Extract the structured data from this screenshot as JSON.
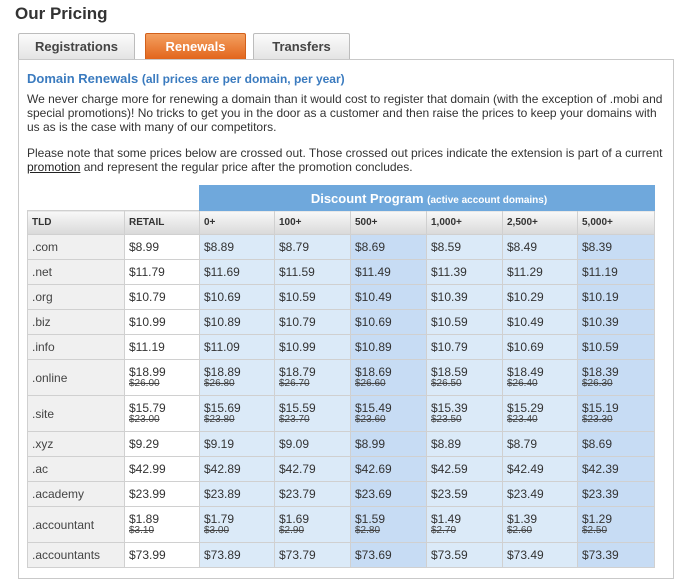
{
  "page_title": "Our Pricing",
  "tabs": [
    {
      "label": "Registrations",
      "active": false
    },
    {
      "label": "Renewals",
      "active": true
    },
    {
      "label": "Transfers",
      "active": false
    }
  ],
  "heading": {
    "title": "Domain Renewals",
    "subtitle": "(all prices are per domain, per year)"
  },
  "intro": "We never charge more for renewing a domain than it would cost to register that domain (with the exception of .mobi and special promotions)! No tricks to get you in the door as a customer and then raise the prices to keep your domains with us as is the case with many of our competitors.",
  "note": {
    "before": "Please note that some prices below are crossed out. Those crossed out prices indicate the extension is part of a current ",
    "link": "promotion",
    "after": " and represent the regular price after the promotion concludes."
  },
  "discount_header": {
    "title": "Discount Program",
    "subtitle": "(active account domains)"
  },
  "columns": [
    "TLD",
    "RETAIL",
    "0+",
    "100+",
    "500+",
    "1,000+",
    "2,500+",
    "5,000+"
  ],
  "colors": {
    "tab_active": "#e2651c",
    "heading": "#3b7bbf",
    "discount_header": "#6fa8dc"
  },
  "rows": [
    {
      "tld": ".com",
      "prices": [
        {
          "p": "$8.99"
        },
        {
          "p": "$8.89"
        },
        {
          "p": "$8.79"
        },
        {
          "p": "$8.69"
        },
        {
          "p": "$8.59"
        },
        {
          "p": "$8.49"
        },
        {
          "p": "$8.39"
        }
      ]
    },
    {
      "tld": ".net",
      "prices": [
        {
          "p": "$11.79"
        },
        {
          "p": "$11.69"
        },
        {
          "p": "$11.59"
        },
        {
          "p": "$11.49"
        },
        {
          "p": "$11.39"
        },
        {
          "p": "$11.29"
        },
        {
          "p": "$11.19"
        }
      ]
    },
    {
      "tld": ".org",
      "prices": [
        {
          "p": "$10.79"
        },
        {
          "p": "$10.69"
        },
        {
          "p": "$10.59"
        },
        {
          "p": "$10.49"
        },
        {
          "p": "$10.39"
        },
        {
          "p": "$10.29"
        },
        {
          "p": "$10.19"
        }
      ]
    },
    {
      "tld": ".biz",
      "prices": [
        {
          "p": "$10.99"
        },
        {
          "p": "$10.89"
        },
        {
          "p": "$10.79"
        },
        {
          "p": "$10.69"
        },
        {
          "p": "$10.59"
        },
        {
          "p": "$10.49"
        },
        {
          "p": "$10.39"
        }
      ]
    },
    {
      "tld": ".info",
      "prices": [
        {
          "p": "$11.19"
        },
        {
          "p": "$11.09"
        },
        {
          "p": "$10.99"
        },
        {
          "p": "$10.89"
        },
        {
          "p": "$10.79"
        },
        {
          "p": "$10.69"
        },
        {
          "p": "$10.59"
        }
      ]
    },
    {
      "tld": ".online",
      "prices": [
        {
          "p": "$18.99",
          "old": "$26.00"
        },
        {
          "p": "$18.89",
          "old": "$26.80"
        },
        {
          "p": "$18.79",
          "old": "$26.70"
        },
        {
          "p": "$18.69",
          "old": "$26.60"
        },
        {
          "p": "$18.59",
          "old": "$26.50"
        },
        {
          "p": "$18.49",
          "old": "$26.40"
        },
        {
          "p": "$18.39",
          "old": "$26.30"
        }
      ]
    },
    {
      "tld": ".site",
      "prices": [
        {
          "p": "$15.79",
          "old": "$23.00"
        },
        {
          "p": "$15.69",
          "old": "$23.80"
        },
        {
          "p": "$15.59",
          "old": "$23.70"
        },
        {
          "p": "$15.49",
          "old": "$23.60"
        },
        {
          "p": "$15.39",
          "old": "$23.50"
        },
        {
          "p": "$15.29",
          "old": "$23.40"
        },
        {
          "p": "$15.19",
          "old": "$23.30"
        }
      ]
    },
    {
      "tld": ".xyz",
      "prices": [
        {
          "p": "$9.29"
        },
        {
          "p": "$9.19"
        },
        {
          "p": "$9.09"
        },
        {
          "p": "$8.99"
        },
        {
          "p": "$8.89"
        },
        {
          "p": "$8.79"
        },
        {
          "p": "$8.69"
        }
      ]
    },
    {
      "tld": ".ac",
      "prices": [
        {
          "p": "$42.99"
        },
        {
          "p": "$42.89"
        },
        {
          "p": "$42.79"
        },
        {
          "p": "$42.69"
        },
        {
          "p": "$42.59"
        },
        {
          "p": "$42.49"
        },
        {
          "p": "$42.39"
        }
      ]
    },
    {
      "tld": ".academy",
      "prices": [
        {
          "p": "$23.99"
        },
        {
          "p": "$23.89"
        },
        {
          "p": "$23.79"
        },
        {
          "p": "$23.69"
        },
        {
          "p": "$23.59"
        },
        {
          "p": "$23.49"
        },
        {
          "p": "$23.39"
        }
      ]
    },
    {
      "tld": ".accountant",
      "prices": [
        {
          "p": "$1.89",
          "old": "$3.10"
        },
        {
          "p": "$1.79",
          "old": "$3.00"
        },
        {
          "p": "$1.69",
          "old": "$2.90"
        },
        {
          "p": "$1.59",
          "old": "$2.80"
        },
        {
          "p": "$1.49",
          "old": "$2.70"
        },
        {
          "p": "$1.39",
          "old": "$2.60"
        },
        {
          "p": "$1.29",
          "old": "$2.50"
        }
      ]
    },
    {
      "tld": ".accountants",
      "prices": [
        {
          "p": "$73.99"
        },
        {
          "p": "$73.89"
        },
        {
          "p": "$73.79"
        },
        {
          "p": "$73.69"
        },
        {
          "p": "$73.59"
        },
        {
          "p": "$73.49"
        },
        {
          "p": "$73.39"
        }
      ]
    }
  ]
}
